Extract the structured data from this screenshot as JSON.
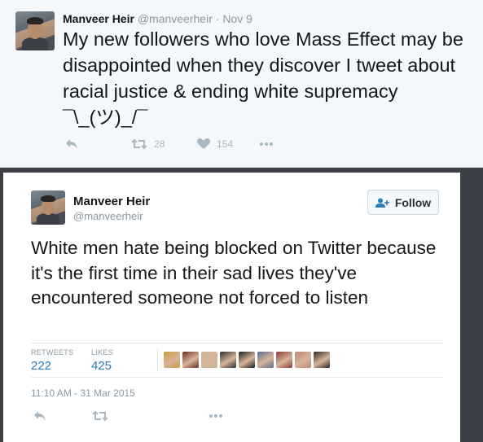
{
  "tweet1": {
    "name": "Manveer Heir",
    "handle": "@manveerheir",
    "separator": "·",
    "date": "Nov 9",
    "text": "My new followers who love Mass Effect may be disappointed when they discover I tweet about racial justice & ending white supremacy ¯\\_(ツ)_/¯",
    "retweets": "28",
    "likes": "154"
  },
  "tweet2": {
    "name": "Manveer Heir",
    "handle": "@manveerheir",
    "follow_label": "Follow",
    "text": "White men hate being blocked on Twitter because it's the first time in their sad lives they've encountered someone not forced to listen",
    "retweets_label": "RETWEETS",
    "retweets": "222",
    "likes_label": "LIKES",
    "likes": "425",
    "likers": [
      "#c89a3c",
      "#6a2f2a",
      "#c8b89a",
      "#2a2a30",
      "#1e1e22",
      "#5a6d86",
      "#8a3b38",
      "#b88a7a",
      "#2e2624"
    ],
    "timestamp": "11:10 AM - 31 Mar 2015"
  },
  "icons": {
    "reply": "reply-icon",
    "retweet": "retweet-icon",
    "like": "heart-icon",
    "more": "more-icon",
    "follow": "add-user-icon"
  },
  "colors": {
    "link_blue": "#2b7bb9",
    "muted": "#8899a6",
    "icon_grey": "#aab8c2"
  }
}
